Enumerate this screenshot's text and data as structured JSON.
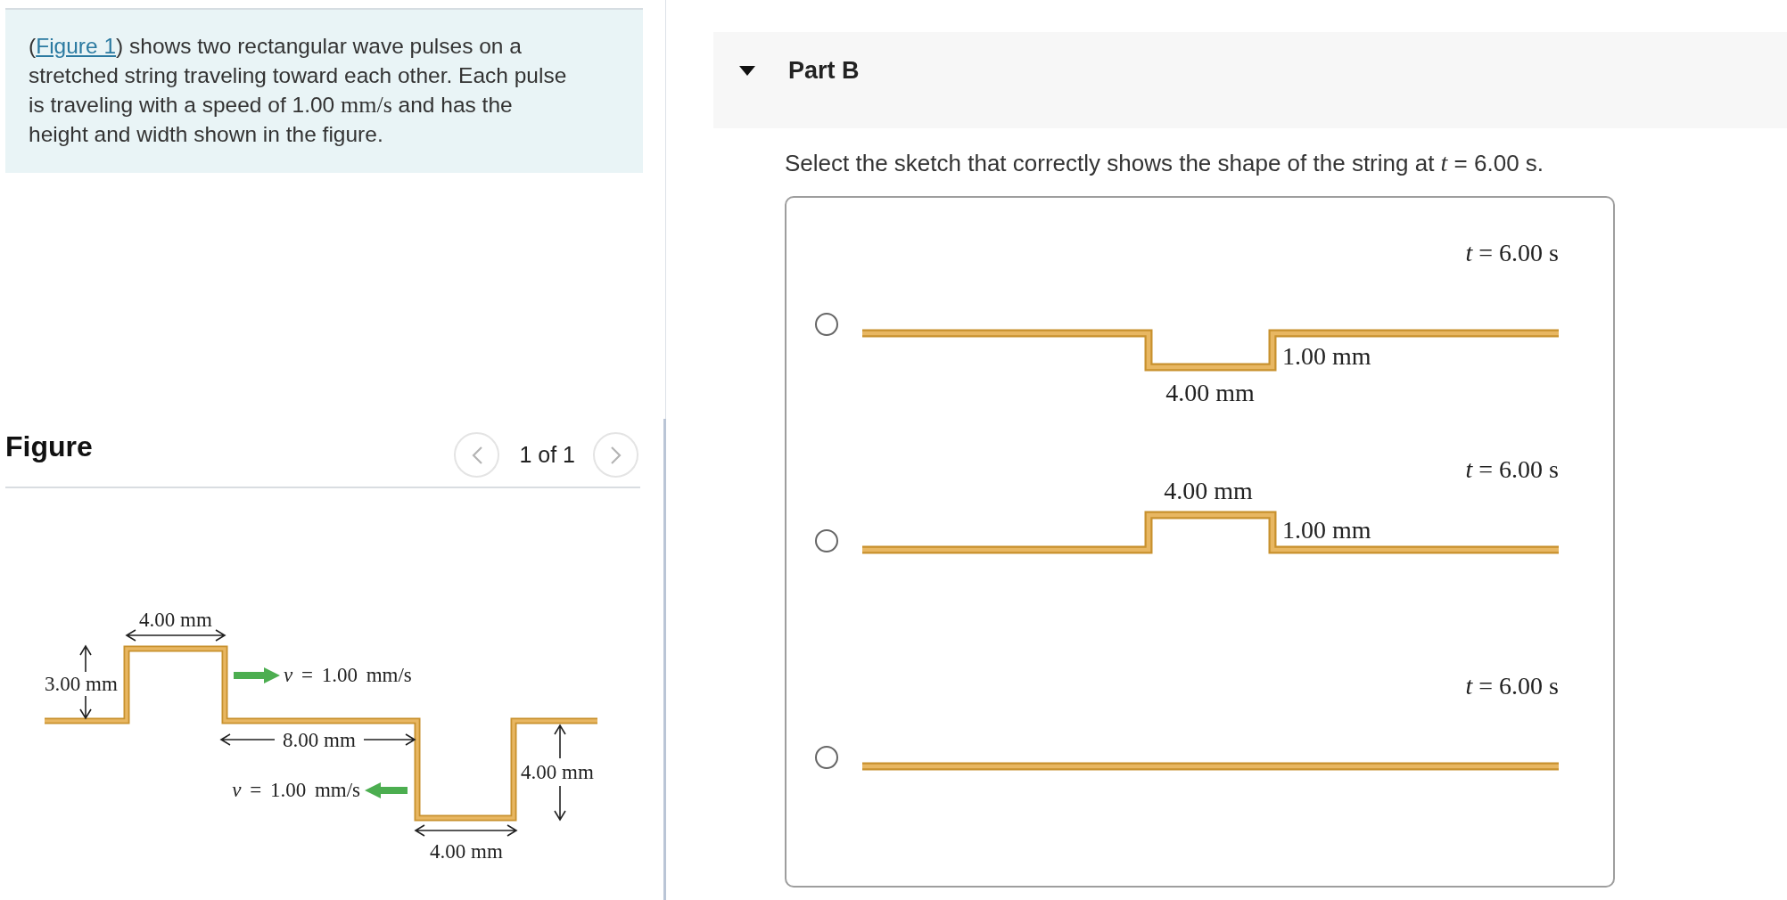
{
  "intro": {
    "before": "(",
    "link": "Figure 1",
    "after": ") shows two rectangular wave pulses on a stretched string traveling toward each other. Each pulse is traveling with a speed of 1.00 ",
    "unit": "mm/s",
    "end": " and has the height and width shown in the figure."
  },
  "figure_panel": {
    "title": "Figure",
    "pager": "1 of 1",
    "prev": {
      "disabled": true
    },
    "next": {
      "disabled": true
    }
  },
  "figure": {
    "width_top": "4.00 mm",
    "height_left": "3.00 mm",
    "velocity_right": "*v* = 1.00 mm/s",
    "gap": "8.00 mm",
    "velocity_left": "*v* = 1.00 mm/s",
    "depth_right": "4.00 mm",
    "width_bottom": "4.00 mm"
  },
  "part": {
    "title": "Part B",
    "expanded": true,
    "question": "Select the sketch that correctly shows the shape of the string at *t* = 6.00 s.",
    "options": [
      {
        "selected": false,
        "kind": "dip",
        "time_label": "*t* = 6.00 s",
        "width_label": "4.00 mm",
        "height_label": "1.00 mm"
      },
      {
        "selected": false,
        "kind": "bump",
        "time_label": "*t* = 6.00 s",
        "width_label": "4.00 mm",
        "height_label": "1.00 mm"
      },
      {
        "selected": false,
        "kind": "flat",
        "time_label": "*t* = 6.00 s"
      }
    ]
  }
}
